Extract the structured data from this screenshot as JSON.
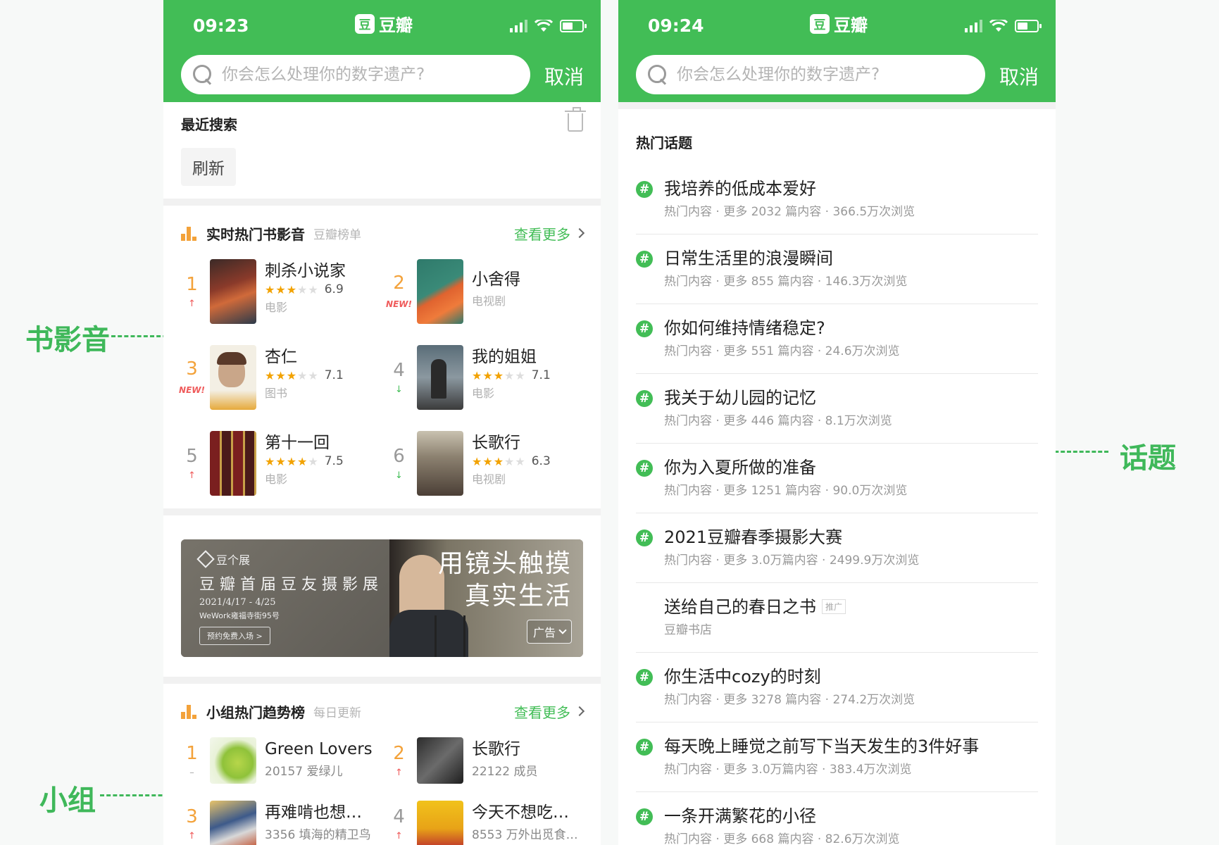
{
  "annotations": {
    "book_film_music": "书影音",
    "group": "小组",
    "topic": "话题"
  },
  "colors": {
    "brand": "#42bd56",
    "rank_orange": "#f3a23a",
    "trend_up": "#ef5b5b",
    "trend_down": "#42bd56",
    "star": "#f2a200"
  },
  "screens": [
    {
      "time": "09:23",
      "logo_text": "豆瓣",
      "logo_glyph": "豆",
      "search_placeholder": "你会怎么处理你的数字遗产?",
      "cancel_label": "取消"
    },
    {
      "time": "09:24",
      "logo_text": "豆瓣",
      "logo_glyph": "豆",
      "search_placeholder": "你会怎么处理你的数字遗产?",
      "cancel_label": "取消"
    }
  ],
  "recent": {
    "title": "最近搜索",
    "chips": [
      "刷新"
    ]
  },
  "hot_media": {
    "title": "实时热门书影音",
    "subtitle": "豆瓣榜单",
    "more_label": "查看更多",
    "items": [
      {
        "rank": "1",
        "trend": "↑",
        "title": "刺杀小说家",
        "rating": "6.9",
        "stars": 3.5,
        "kind": "电影"
      },
      {
        "rank": "2",
        "trend": "NEW!",
        "title": "小舍得",
        "rating": "",
        "stars": 0,
        "kind": "电视剧"
      },
      {
        "rank": "3",
        "trend": "NEW!",
        "title": "杏仁",
        "rating": "7.1",
        "stars": 3.5,
        "kind": "图书"
      },
      {
        "rank": "4",
        "trend": "↓",
        "title": "我的姐姐",
        "rating": "7.1",
        "stars": 3.5,
        "kind": "电影"
      },
      {
        "rank": "5",
        "trend": "↑",
        "title": "第十一回",
        "rating": "7.5",
        "stars": 4,
        "kind": "电影"
      },
      {
        "rank": "6",
        "trend": "↓",
        "title": "长歌行",
        "rating": "6.3",
        "stars": 3,
        "kind": "电视剧"
      }
    ]
  },
  "banner": {
    "brand": "豆个展",
    "line1": "豆瓣首届豆友摄影展",
    "date": "2021/4/17 - 4/25",
    "venue": "WeWork雍福寺街95号",
    "button": "预约免费入场 >",
    "headline1": "用镜头触摸",
    "headline2": "真实生活",
    "ad_label": "广告"
  },
  "groups": {
    "title": "小组热门趋势榜",
    "subtitle": "每日更新",
    "more_label": "查看更多",
    "items": [
      {
        "rank": "1",
        "trend": "–",
        "name": "Green Lovers",
        "meta": "20157 爱绿儿"
      },
      {
        "rank": "2",
        "trend": "↑",
        "name": "长歌行",
        "meta": "22122 成员"
      },
      {
        "rank": "3",
        "trend": "↑",
        "name": "再难啃也想…",
        "meta": "3356 填海的精卫鸟"
      },
      {
        "rank": "4",
        "trend": "↑",
        "name": "今天不想吃…",
        "meta": "8553 万外出觅食…"
      }
    ]
  },
  "topics": {
    "title": "热门话题",
    "items": [
      {
        "title": "我培养的低成本爱好",
        "meta": "热门内容 · 更多 2032 篇内容 · 366.5万次浏览",
        "promo": false
      },
      {
        "title": "日常生活里的浪漫瞬间",
        "meta": "热门内容 · 更多 855 篇内容 · 146.3万次浏览",
        "promo": false
      },
      {
        "title": "你如何维持情绪稳定?",
        "meta": "热门内容 · 更多 551 篇内容 · 24.6万次浏览",
        "promo": false
      },
      {
        "title": "我关于幼儿园的记忆",
        "meta": "热门内容 · 更多 446 篇内容 · 8.1万次浏览",
        "promo": false
      },
      {
        "title": "你为入夏所做的准备",
        "meta": "热门内容 · 更多 1251 篇内容 · 90.0万次浏览",
        "promo": false
      },
      {
        "title": "2021豆瓣春季摄影大赛",
        "meta": "热门内容 · 更多 3.0万篇内容 · 2499.9万次浏览",
        "promo": false
      },
      {
        "title": "送给自己的春日之书",
        "meta": "豆瓣书店",
        "promo": true,
        "promo_label": "推广"
      },
      {
        "title": "你生活中cozy的时刻",
        "meta": "热门内容 · 更多 3278 篇内容 · 274.2万次浏览",
        "promo": false
      },
      {
        "title": "每天晚上睡觉之前写下当天发生的3件好事",
        "meta": "热门内容 · 更多 3.0万篇内容 · 383.4万次浏览",
        "promo": false
      },
      {
        "title": "一条开满繁花的小径",
        "meta": "热门内容 · 更多 668 篇内容 · 82.6万次浏览",
        "promo": false
      }
    ]
  }
}
